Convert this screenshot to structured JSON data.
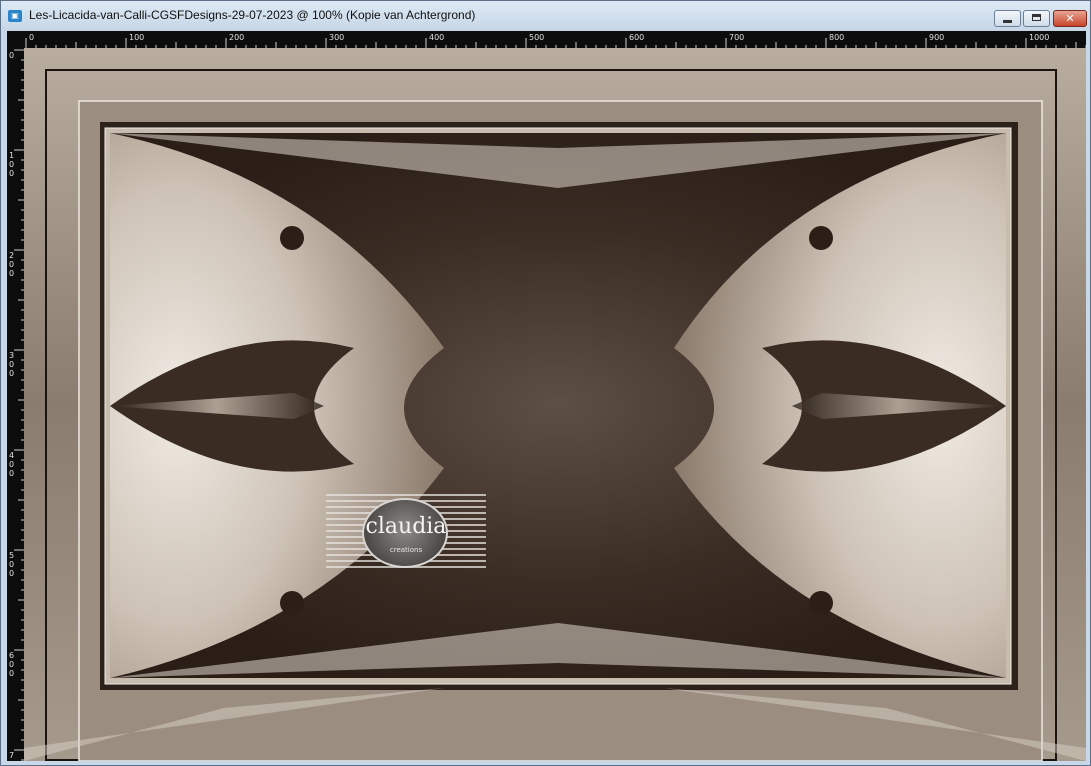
{
  "window": {
    "title": "Les-Licacida-van-Calli-CGSFDesigns-29-07-2023 @ 100% (Kopie van Achtergrond)",
    "app_icon": "image-document-icon",
    "buttons": {
      "minimize": "minimize-icon",
      "maximize": "maximize-icon",
      "close": "close-icon",
      "close_glyph": "✕"
    },
    "colors": {
      "titlebar": "#d3e1ef",
      "close": "#c7452c",
      "ruler": "#0d0d0d"
    }
  },
  "rulers": {
    "horizontal": [
      "0",
      "100",
      "200",
      "300",
      "400",
      "500",
      "600",
      "700",
      "800",
      "900",
      "1000"
    ],
    "vertical": [
      "0",
      "100",
      "200",
      "300",
      "400",
      "500",
      "600",
      "700"
    ]
  },
  "canvas": {
    "zoom": "100%",
    "layer": "Kopie van Achtergrond",
    "palette": {
      "dark": "#2e231c",
      "mid": "#7a6a5c",
      "light": "#e6dfd6"
    }
  },
  "watermark": {
    "text": "claudia",
    "subtext": "creations"
  }
}
